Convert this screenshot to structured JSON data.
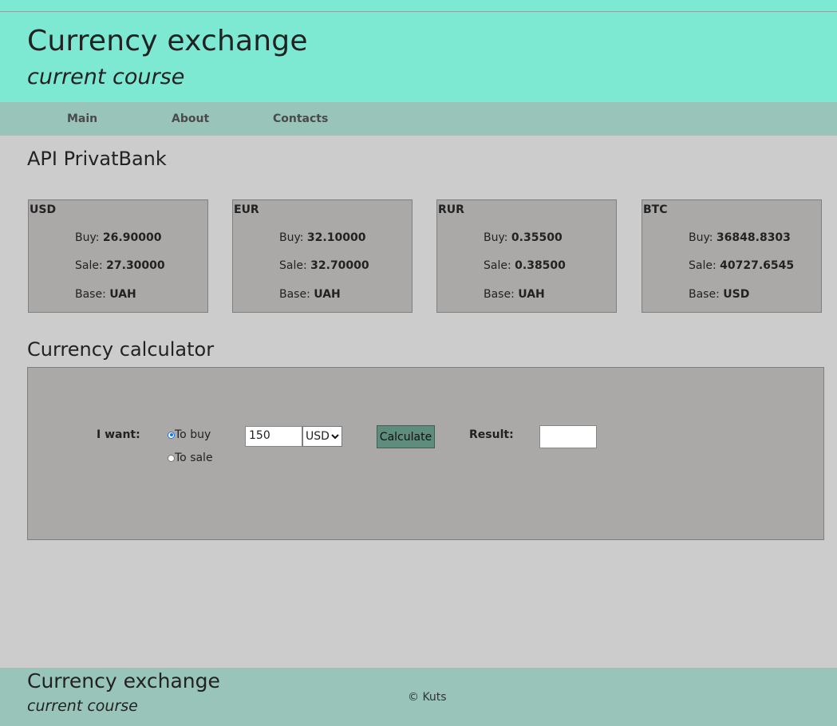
{
  "header": {
    "title": "Currency exchange",
    "subtitle": "current course"
  },
  "nav": {
    "items": [
      {
        "label": "Main"
      },
      {
        "label": "About"
      },
      {
        "label": "Contacts"
      }
    ]
  },
  "api_section": {
    "title": "API PrivatBank",
    "cards": [
      {
        "code": "USD",
        "buy_label": "Buy:",
        "buy": "26.90000",
        "sale_label": "Sale:",
        "sale": "27.30000",
        "base_label": "Base:",
        "base": "UAH"
      },
      {
        "code": "EUR",
        "buy_label": "Buy:",
        "buy": "32.10000",
        "sale_label": "Sale:",
        "sale": "32.70000",
        "base_label": "Base:",
        "base": "UAH"
      },
      {
        "code": "RUR",
        "buy_label": "Buy:",
        "buy": "0.35500",
        "sale_label": "Sale:",
        "sale": "0.38500",
        "base_label": "Base:",
        "base": "UAH"
      },
      {
        "code": "BTC",
        "buy_label": "Buy:",
        "buy": "36848.8303",
        "sale_label": "Sale:",
        "sale": "40727.6545",
        "base_label": "Base:",
        "base": "USD"
      }
    ]
  },
  "calculator": {
    "title": "Currency calculator",
    "want_label": "I want:",
    "options": [
      {
        "label": "To buy",
        "checked": true
      },
      {
        "label": "To sale",
        "checked": false
      }
    ],
    "amount": "150",
    "currency_selected": "USD",
    "calculate_label": "Calculate",
    "result_label": "Result:",
    "result_value": ""
  },
  "footer": {
    "title": "Currency exchange",
    "subtitle": "current course",
    "copyright": "© Kuts"
  }
}
